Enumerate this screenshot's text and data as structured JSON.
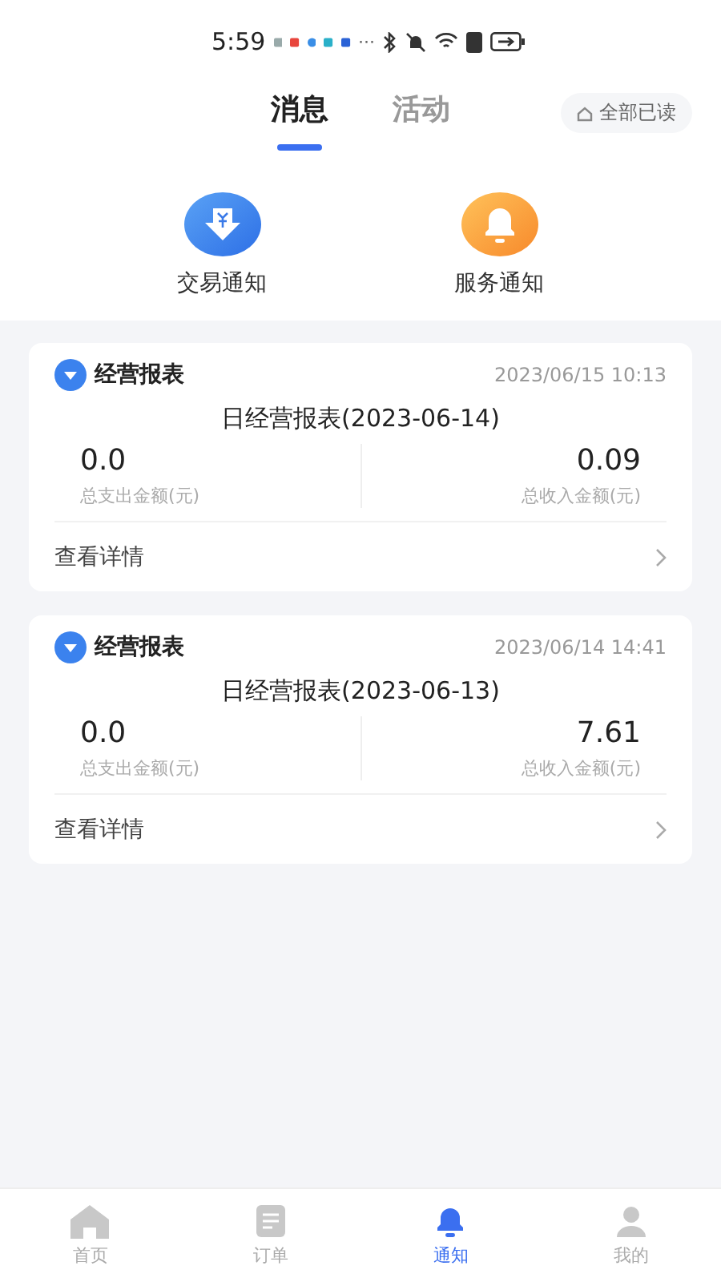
{
  "status_bar": {
    "time": "5:59",
    "more": "···"
  },
  "tabs": [
    {
      "label": "消息",
      "selected": true
    },
    {
      "label": "活动",
      "selected": false
    }
  ],
  "mark_all_read": "全部已读",
  "shortcuts": [
    {
      "label": "交易通知",
      "kind": "trade"
    },
    {
      "label": "服务通知",
      "kind": "service"
    }
  ],
  "reports": [
    {
      "source": "经营报表",
      "time": "2023/06/15 10:13",
      "title": "日经营报表(2023-06-14)",
      "expense": "0.0",
      "expense_label": "总支出金额(元)",
      "income": "0.09",
      "income_label": "总收入金额(元)",
      "details": "查看详情"
    },
    {
      "source": "经营报表",
      "time": "2023/06/14 14:41",
      "title": "日经营报表(2023-06-13)",
      "expense": "0.0",
      "expense_label": "总支出金额(元)",
      "income": "7.61",
      "income_label": "总收入金额(元)",
      "details": "查看详情"
    }
  ],
  "bottom_nav": [
    {
      "label": "首页",
      "kind": "home",
      "selected": false
    },
    {
      "label": "订单",
      "kind": "order",
      "selected": false
    },
    {
      "label": "通知",
      "kind": "notice",
      "selected": true
    },
    {
      "label": "我的",
      "kind": "me",
      "selected": false
    }
  ]
}
